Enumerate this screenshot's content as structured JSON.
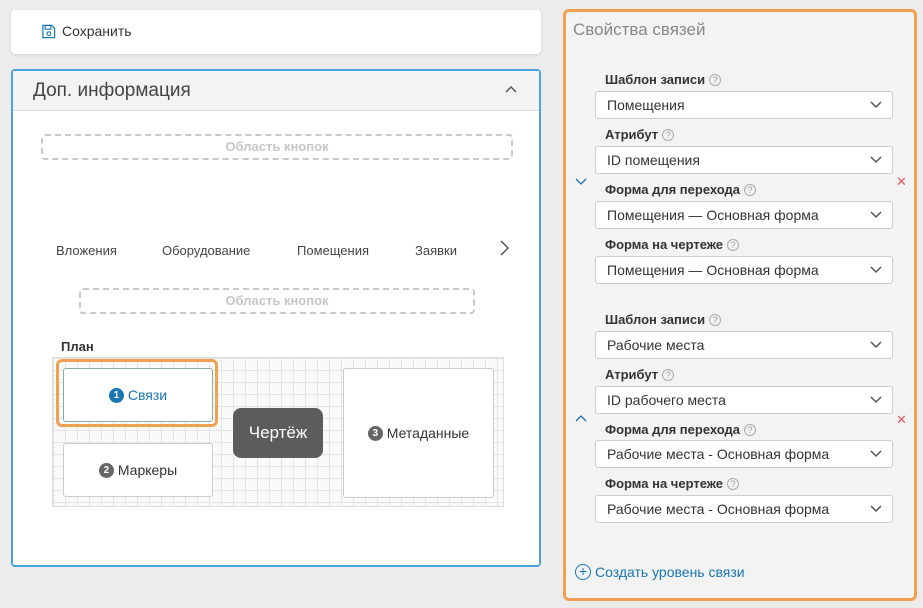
{
  "toolbar": {
    "save_label": "Сохранить",
    "save_icon": "floppy-disk-icon"
  },
  "info_panel": {
    "title": "Доп. информация",
    "button_area_label": "Область кнопок",
    "tabs": [
      "Вложения",
      "Оборудование",
      "Помещения",
      "Заявки"
    ],
    "plan": {
      "label": "План",
      "cards": [
        {
          "num": "1",
          "label": "Связи"
        },
        {
          "num": "2",
          "label": "Маркеры"
        },
        {
          "num": "3",
          "label": "Метаданные"
        }
      ],
      "drawing_label": "Чертёж"
    }
  },
  "props_panel": {
    "title": "Свойства связей",
    "groups": [
      {
        "template_label": "Шаблон записи",
        "template_value": "Помещения",
        "attribute_label": "Атрибут",
        "attribute_value": "ID помещения",
        "nav_form_label": "Форма для перехода",
        "nav_form_value": "Помещения — Основная форма",
        "drawing_form_label": "Форма на чертеже",
        "drawing_form_value": "Помещения — Основная форма"
      },
      {
        "template_label": "Шаблон записи",
        "template_value": "Рабочие места",
        "attribute_label": "Атрибут",
        "attribute_value": "ID рабочего места",
        "nav_form_label": "Форма для перехода",
        "nav_form_value": "Рабочие места - Основная форма",
        "drawing_form_label": "Форма на чертеже",
        "drawing_form_value": "Рабочие места - Основная форма"
      }
    ],
    "help_glyph": "?",
    "remove_glyph": "✕",
    "create_level_label": "Создать уровень связи"
  },
  "colors": {
    "accent": "#1976b4",
    "highlight": "#f0a050",
    "remove": "#e05a5a",
    "panel_border": "#4aa3df"
  }
}
